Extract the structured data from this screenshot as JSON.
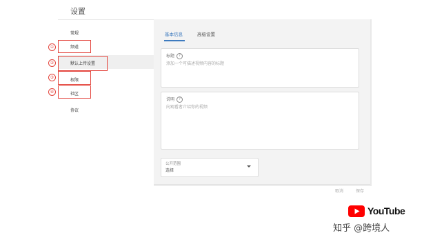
{
  "page": {
    "title": "设置"
  },
  "sidebar": {
    "items": [
      {
        "label": "常规",
        "marker": ""
      },
      {
        "label": "频道",
        "marker": "①"
      },
      {
        "label": "默认上传设置",
        "marker": "②"
      },
      {
        "label": "权限",
        "marker": "③"
      },
      {
        "label": "社区",
        "marker": "④"
      },
      {
        "label": "协议",
        "marker": ""
      }
    ]
  },
  "tabs": [
    {
      "label": "基本信息",
      "active": true
    },
    {
      "label": "高级设置",
      "active": false
    }
  ],
  "fields": {
    "title": {
      "label": "标题",
      "help_icon": "help-icon",
      "placeholder": "添加一个可描述视频内容的标题"
    },
    "description": {
      "label": "说明",
      "help_icon": "help-icon",
      "placeholder": "向观看者介绍你的视频"
    },
    "visibility": {
      "label": "公开范围",
      "value": "选择"
    }
  },
  "footer": {
    "buttons": [
      "取消",
      "保存"
    ]
  },
  "watermark": {
    "youtube": "YouTube",
    "zhihu": "知乎 @跨境人"
  },
  "colors": {
    "accent": "#3e7bbf",
    "annotation": "#e3433b",
    "youtube_red": "#ff0000"
  }
}
